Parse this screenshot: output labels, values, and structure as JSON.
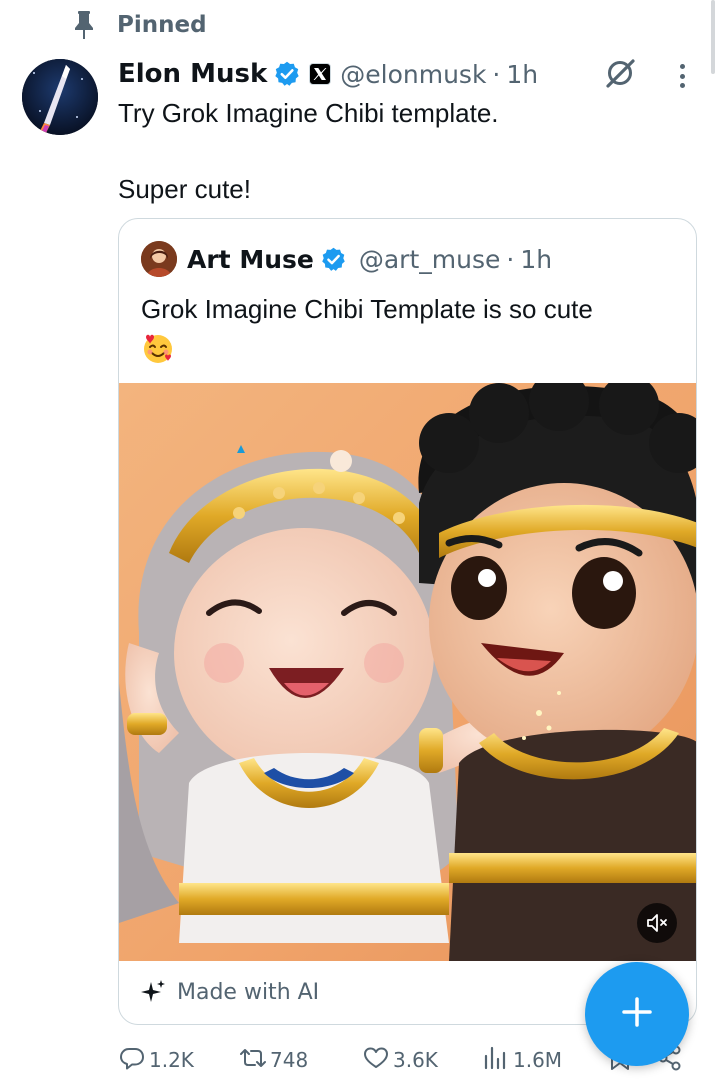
{
  "pinned": {
    "label": "Pinned",
    "icon": "pin-icon"
  },
  "tweet": {
    "author": {
      "name": "Elon Musk",
      "handle": "@elonmusk",
      "time": "1h",
      "verified_icon": "verified-badge-icon",
      "affiliate_icon": "x-logo-icon"
    },
    "text_lines": [
      "Try Grok Imagine Chibi template.",
      "",
      "Super cute!"
    ],
    "menu": {
      "grok_icon": "grok-icon",
      "more_icon": "more-dots-icon"
    },
    "quote": {
      "author": {
        "name": "Art Muse",
        "handle": "@art_muse",
        "time": "1h"
      },
      "text": "Grok Imagine Chibi Template is so cute",
      "emoji": "🥰",
      "media": {
        "type": "video",
        "mute_icon": "volume-muted-icon"
      },
      "ai_label": "Made with AI"
    },
    "actions": {
      "replies": "1.2K",
      "reposts": "748",
      "likes": "3.6K",
      "views": "1.6M"
    }
  },
  "fab": {
    "icon": "plus-icon"
  },
  "colors": {
    "accent": "#1d9bf0",
    "secondary_text": "#536471",
    "border": "#cfd9de"
  }
}
